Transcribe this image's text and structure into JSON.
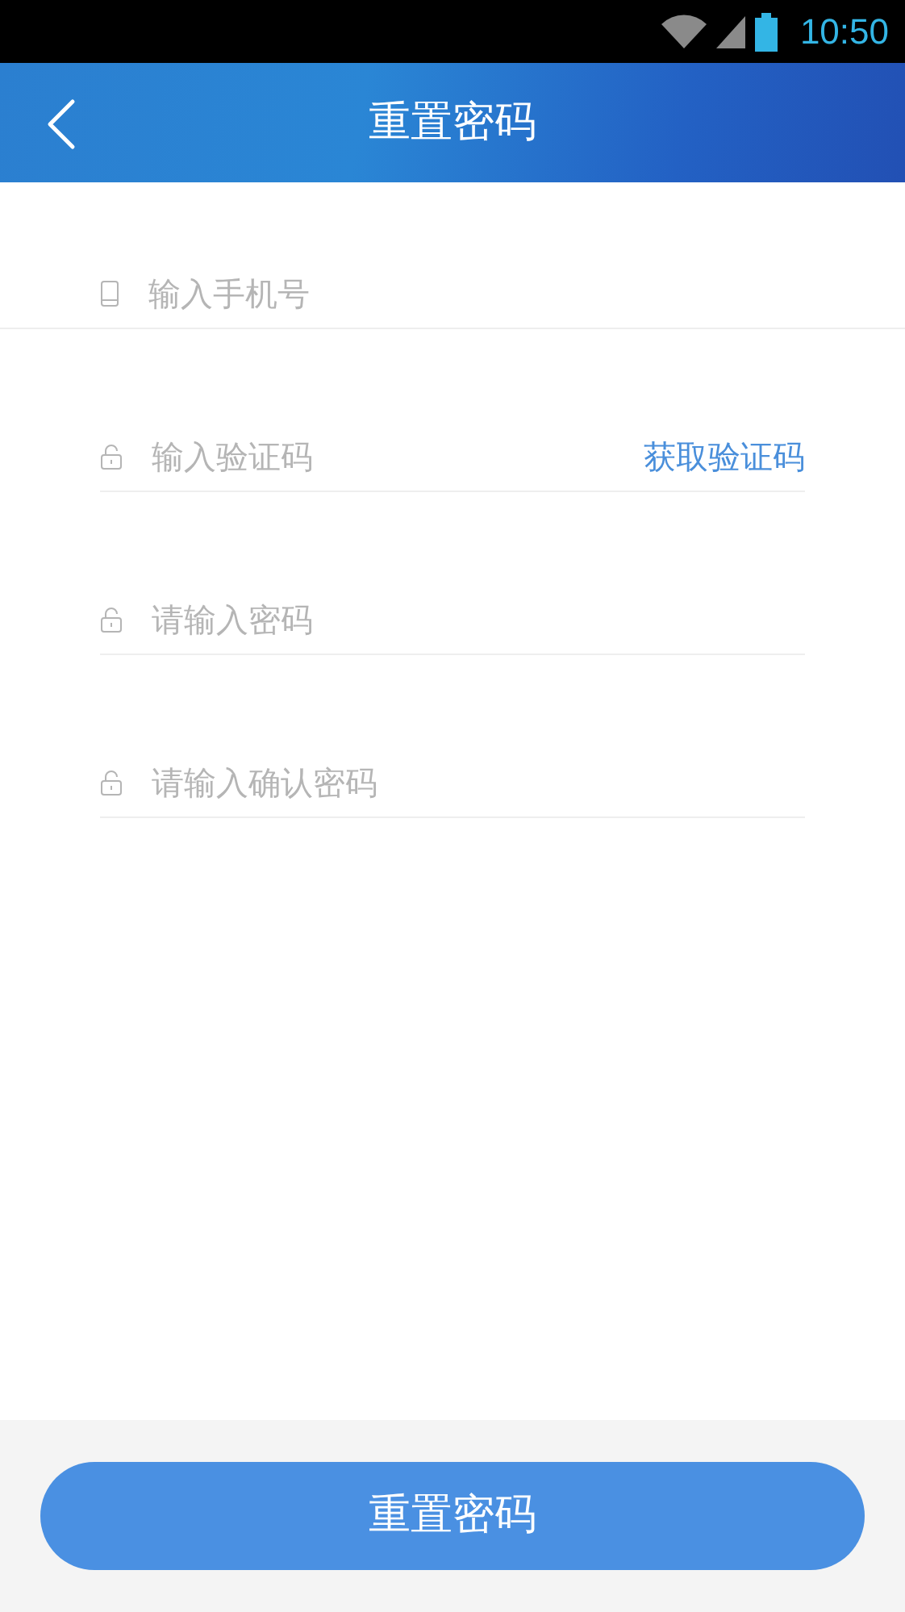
{
  "status_bar": {
    "time": "10:50"
  },
  "header": {
    "title": "重置密码"
  },
  "fields": [
    {
      "kind": "phone",
      "placeholder": "输入手机号",
      "full_width_divider": true
    },
    {
      "kind": "lock",
      "placeholder": "输入验证码",
      "action": "获取验证码",
      "full_width_divider": false
    },
    {
      "kind": "lock",
      "placeholder": "请输入密码",
      "full_width_divider": false
    },
    {
      "kind": "lock",
      "placeholder": "请输入确认密码",
      "full_width_divider": false
    }
  ],
  "submit_button": {
    "label": "重置密码"
  }
}
